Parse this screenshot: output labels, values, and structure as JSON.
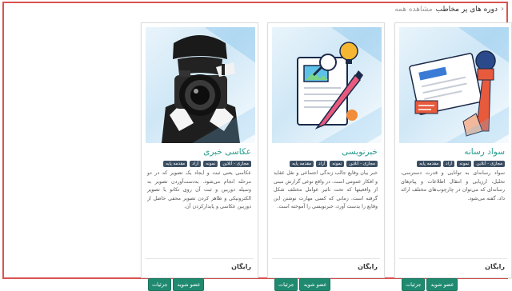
{
  "header": {
    "title": "دوره های پر مخاطب",
    "subtitle": "مشاهده همه",
    "chevron_icon": "chevron-left-icon"
  },
  "cards": [
    {
      "title": "عکاسی خبری",
      "badges": [
        "مجازی - آنلاین",
        "نمونه",
        "آزاد",
        "مقدمه پایه"
      ],
      "description": "عکاسی یعنی ثبت و ایجاد یک تصویر که در دو مرحله انجام می‌شود. به‌دست‌آوردن تصویر به وسیله دوربین و ثبت آن روی تکانو یا تصویر الکترونیکی و ظاهر کردن تصویر محفی حاصل از دوربین عکاسی و پایدارکردن آن.",
      "price": "رایگان",
      "enroll_label": "عضو شوید",
      "details_label": "جزئیات",
      "image_icon": "photographer-camera-icon"
    },
    {
      "title": "خبرنویسی",
      "badges": [
        "مجازی - آنلاین",
        "نمونه",
        "آزاد",
        "مقدمه پایه"
      ],
      "description": "خبر بیان وقایع جالب زندگی اجتماعی و نقل عقاید و افکار عمومی است. در واقع نوعی گزارش مبنی از واقعیتها که تحت تاثیر عوامل مختلف شکل گرفته است. زمانی که کسی مهارت نوشتن این وقایع را بدست آورد، خبرنویسی را آموخته است.",
      "price": "رایگان",
      "enroll_label": "عضو شوید",
      "details_label": "جزئیات",
      "image_icon": "document-pen-icon"
    },
    {
      "title": "سواد رسانه",
      "badges": [
        "مجازی - آنلاین",
        "نمونه",
        "آزاد",
        "مقدمه پایه"
      ],
      "description": "سواد رسانه‌ای به توانایی و قدرت دسترسی، تحلیل، ارزیابی و انتقال اطلاعات و پیام‌های رسانه‌ای که می‌توان در چارچوب‌های مختلف ارائه داد، گفته می‌شود.",
      "price": "رایگان",
      "enroll_label": "عضو شوید",
      "details_label": "جزئیات",
      "image_icon": "newspaper-microphone-icon"
    }
  ]
}
